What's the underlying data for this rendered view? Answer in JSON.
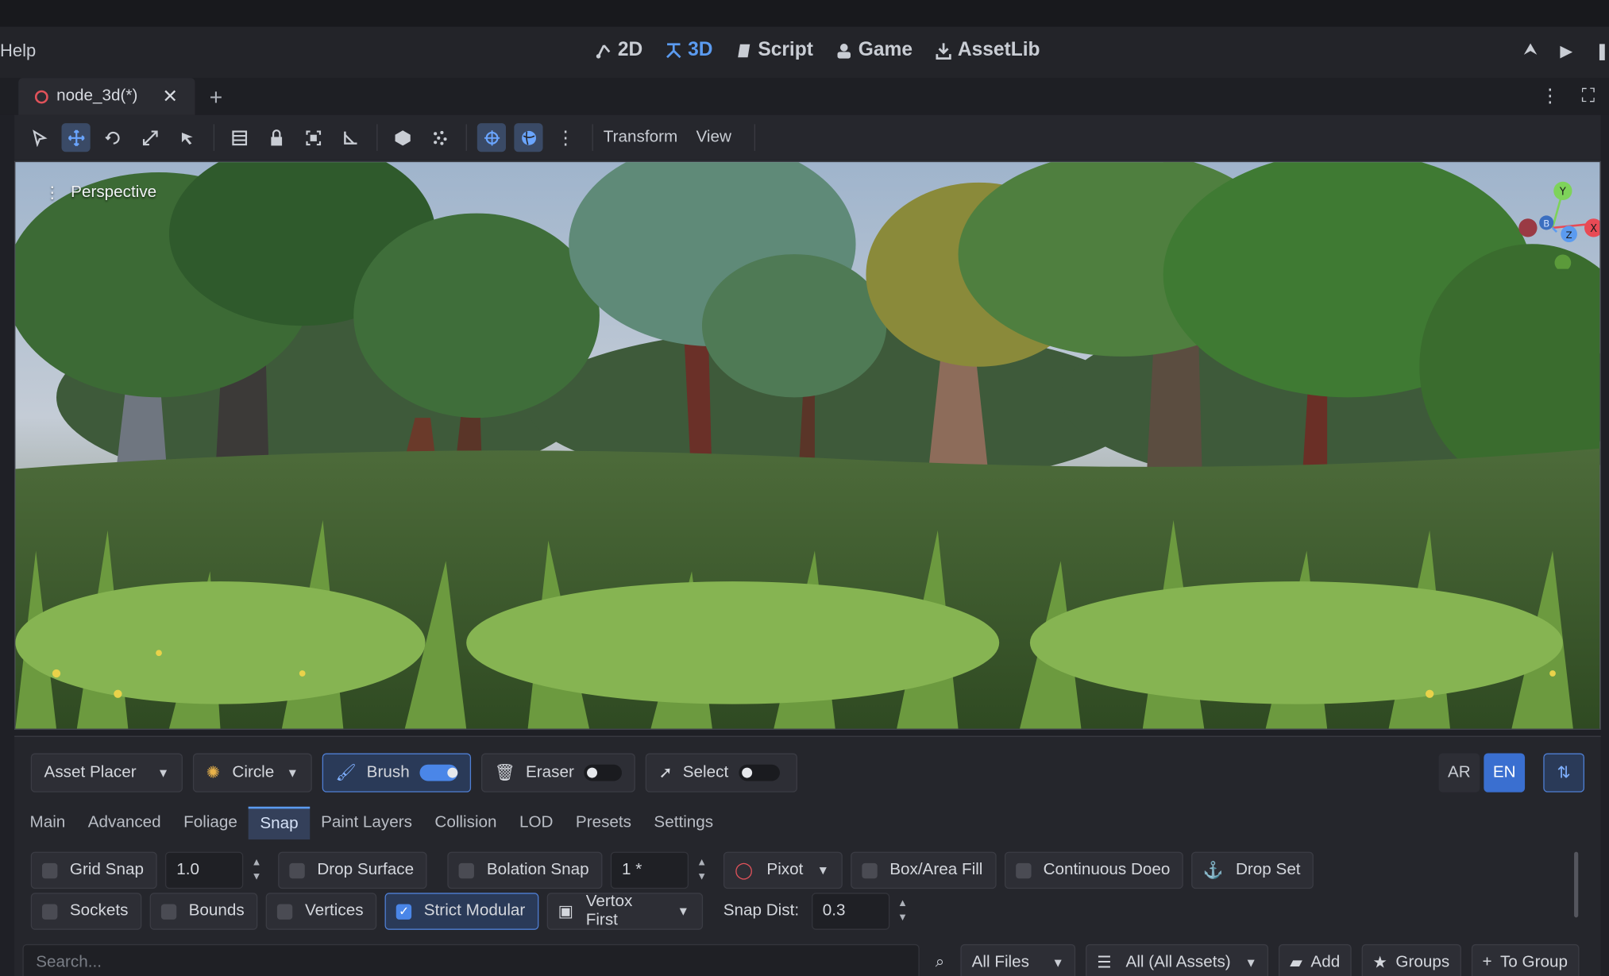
{
  "menu": {
    "help": "Help"
  },
  "workspaces": [
    {
      "label": "2D",
      "icon": "2d-icon"
    },
    {
      "label": "3D",
      "icon": "3d-icon"
    },
    {
      "label": "Script",
      "icon": "script-icon"
    },
    {
      "label": "Game",
      "icon": "game-icon"
    },
    {
      "label": "AssetLib",
      "icon": "download-icon"
    }
  ],
  "scene_tab": {
    "label": "node_3d(*)"
  },
  "toolbar": {
    "transform_menu": "Transform",
    "view_menu": "View"
  },
  "viewport": {
    "perspective_label": "Perspective"
  },
  "gizmo": {
    "x": "X",
    "y": "Y",
    "z": "Z",
    "b": "B"
  },
  "panel": {
    "mode_dropdown": "Asset Placer",
    "shape_dropdown": "Circle",
    "brush_label": "Brush",
    "eraser_label": "Eraser",
    "select_label": "Select",
    "lang_ar": "AR",
    "lang_en": "EN",
    "tabs": [
      "Main",
      "Advanced",
      "Foliage",
      "Snap",
      "Paint Layers",
      "Collision",
      "LOD",
      "Presets",
      "Settings"
    ],
    "grid_snap": "Grid Snap",
    "grid_snap_value": "1.0",
    "drop_surface": "Drop Surface",
    "rotation_snap": "Bolation Snap",
    "rotation_snap_value": "1 *",
    "pivot": "Pixot",
    "box_fill": "Box/Area Fill",
    "continuous_drop": "Continuous Doeo",
    "drop_set": "Drop Set",
    "sockets": "Sockets",
    "bounds": "Bounds",
    "vertices": "Vertices",
    "strict_modular": "Strict Modular",
    "vertex_first": "Vertox First",
    "snap_dist_label": "Snap Dist:",
    "snap_dist_value": "0.3"
  },
  "bottom": {
    "search_placeholder": "Search...",
    "all_files": "All Files",
    "all_assets": "All (All Assets)",
    "add": "Add",
    "groups": "Groups",
    "to_group": "To Group"
  },
  "colors": {
    "accent": "#5b9bf0",
    "active_bg": "#2a3a58",
    "panel_bg": "#25262c"
  }
}
